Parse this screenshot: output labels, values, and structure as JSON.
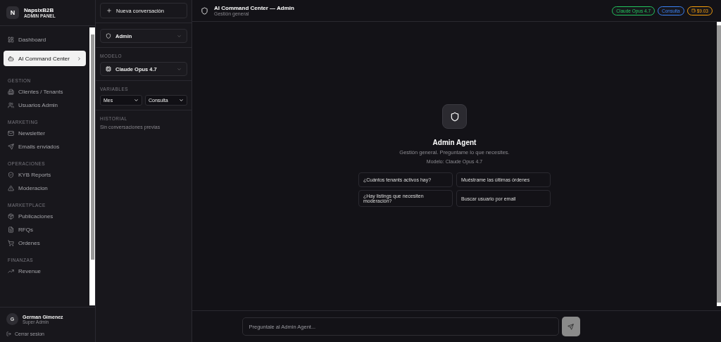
{
  "brand": {
    "initial": "N",
    "name": "NapsixB2B",
    "subtitle": "ADMIN PANEL"
  },
  "nav": [
    {
      "items": [
        {
          "label": "Dashboard",
          "selected": false
        },
        {
          "label": "AI Command Center",
          "selected": true
        }
      ]
    },
    {
      "heading": "GESTION",
      "items": [
        {
          "label": "Clientes / Tenants",
          "selected": false
        },
        {
          "label": "Usuarios Admin",
          "selected": false
        }
      ]
    },
    {
      "heading": "MARKETING",
      "items": [
        {
          "label": "Newsletter",
          "selected": false
        },
        {
          "label": "Emails enviados",
          "selected": false
        }
      ]
    },
    {
      "heading": "OPERACIONES",
      "items": [
        {
          "label": "KYB Reports",
          "selected": false
        },
        {
          "label": "Moderacion",
          "selected": false
        }
      ]
    },
    {
      "heading": "MARKETPLACE",
      "items": [
        {
          "label": "Publicaciones",
          "selected": false
        },
        {
          "label": "RFQs",
          "selected": false
        },
        {
          "label": "Ordenes",
          "selected": false
        }
      ]
    },
    {
      "heading": "FINANZAS",
      "items": [
        {
          "label": "Revenue",
          "selected": false
        }
      ]
    }
  ],
  "user": {
    "initial": "G",
    "name": "German Gimenez",
    "role": "Super Admin",
    "logout": "Cerrar sesion"
  },
  "panel": {
    "new_button": "Nueva conversación",
    "agent": "Admin",
    "model_heading": "MODELO",
    "model": "Claude Opus 4.7",
    "variables_heading": "VARIABLES",
    "variables": [
      "Mes",
      "Consulta"
    ],
    "history_heading": "HISTORIAL",
    "history_empty": "Sin conversaciones previas"
  },
  "header": {
    "title": "AI Command Center — Admin",
    "subtitle": "Gestión general",
    "badges": [
      {
        "label": "Claude Opus 4.7",
        "color": "#22c55e"
      },
      {
        "label": "Consulta",
        "color": "#3b82f6"
      },
      {
        "label": "$9.03",
        "color": "#f59e0b",
        "kind": "cost"
      }
    ]
  },
  "agent": {
    "title": "Admin Agent",
    "description": "Gestión general. Preguntame lo que necesites.",
    "model_line": "Modelo: Claude Opus 4.7",
    "suggestions": [
      "¿Cuántos tenants activos hay?",
      "Muéstrame las últimas órdenes",
      "¿Hay listings que necesiten moderación?",
      "Buscar usuario por email"
    ]
  },
  "composer": {
    "placeholder": "Preguntale al Admin Agent..."
  }
}
